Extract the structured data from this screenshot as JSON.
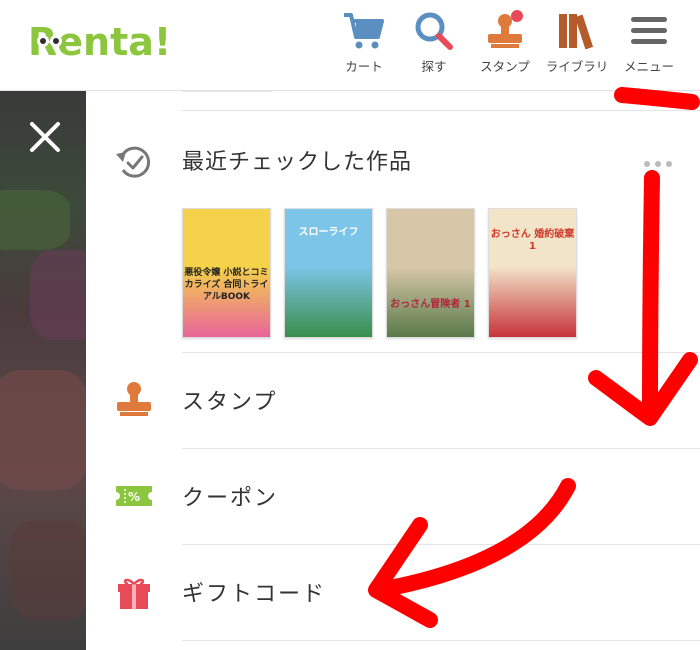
{
  "header": {
    "logo": "Renta!",
    "nav": [
      {
        "label": "カート",
        "icon": "cart-icon"
      },
      {
        "label": "探す",
        "icon": "search-icon"
      },
      {
        "label": "スタンプ",
        "icon": "stamp-icon"
      },
      {
        "label": "ライブラリ",
        "icon": "library-icon"
      },
      {
        "label": "メニュー",
        "icon": "menu-icon"
      }
    ]
  },
  "drawer": {
    "recent": {
      "title": "最近チェックした作品",
      "covers": [
        {
          "title": "悪役令嬢 小説とコミカライズ 合同トライアルBOOK",
          "colors": [
            "#f4d24a",
            "#e8659a"
          ]
        },
        {
          "title": "スローライフ",
          "colors": [
            "#7cc5e8",
            "#3a8e4a"
          ]
        },
        {
          "title": "おっさん冒険者 1",
          "colors": [
            "#d7c7a8",
            "#5a7a4a"
          ]
        },
        {
          "title": "おっさん 婚約破棄 1",
          "colors": [
            "#f2e4c8",
            "#c8323a"
          ]
        }
      ]
    },
    "menu": [
      {
        "label": "スタンプ",
        "icon": "stamp-icon"
      },
      {
        "label": "クーポン",
        "icon": "coupon-icon"
      },
      {
        "label": "ギフトコード",
        "icon": "gift-icon"
      }
    ]
  },
  "colors": {
    "brand": "#8cc63f",
    "accent_icon": "#e07a3c",
    "badge": "#e84b57",
    "annotation": "#ff0000"
  }
}
